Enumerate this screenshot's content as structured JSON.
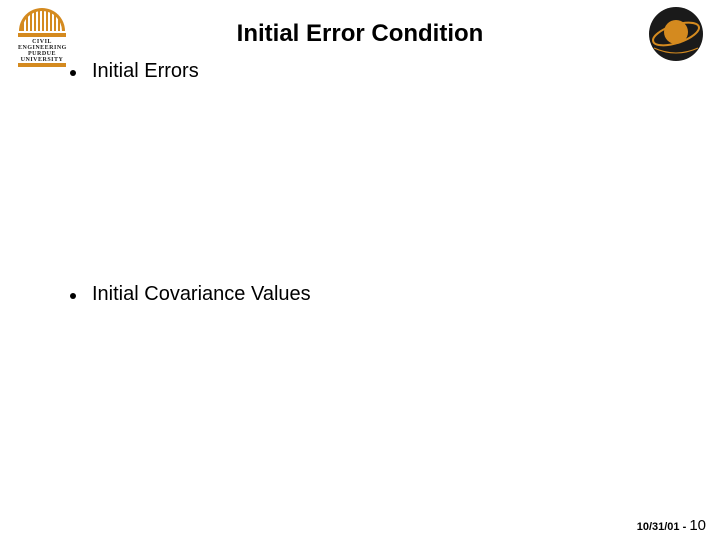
{
  "title": "Initial Error Condition",
  "logo_left": {
    "line1": "CIVIL",
    "line2": "ENGINEERING",
    "line3": "PURDUE",
    "line4": "UNIVERSITY"
  },
  "bullets": [
    {
      "text": "Initial Errors"
    },
    {
      "text": "Initial Covariance Values"
    }
  ],
  "footer": {
    "date": "10/31/01 - ",
    "page": "10"
  }
}
